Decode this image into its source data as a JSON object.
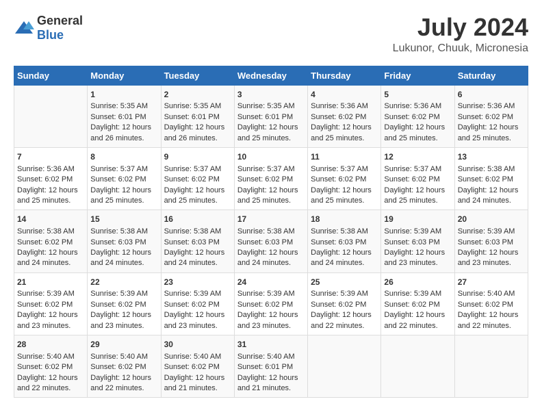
{
  "header": {
    "logo_general": "General",
    "logo_blue": "Blue",
    "month_year": "July 2024",
    "location": "Lukunor, Chuuk, Micronesia"
  },
  "weekdays": [
    "Sunday",
    "Monday",
    "Tuesday",
    "Wednesday",
    "Thursday",
    "Friday",
    "Saturday"
  ],
  "weeks": [
    [
      {
        "day": "",
        "content": ""
      },
      {
        "day": "1",
        "content": "Sunrise: 5:35 AM\nSunset: 6:01 PM\nDaylight: 12 hours\nand 26 minutes."
      },
      {
        "day": "2",
        "content": "Sunrise: 5:35 AM\nSunset: 6:01 PM\nDaylight: 12 hours\nand 26 minutes."
      },
      {
        "day": "3",
        "content": "Sunrise: 5:35 AM\nSunset: 6:01 PM\nDaylight: 12 hours\nand 25 minutes."
      },
      {
        "day": "4",
        "content": "Sunrise: 5:36 AM\nSunset: 6:02 PM\nDaylight: 12 hours\nand 25 minutes."
      },
      {
        "day": "5",
        "content": "Sunrise: 5:36 AM\nSunset: 6:02 PM\nDaylight: 12 hours\nand 25 minutes."
      },
      {
        "day": "6",
        "content": "Sunrise: 5:36 AM\nSunset: 6:02 PM\nDaylight: 12 hours\nand 25 minutes."
      }
    ],
    [
      {
        "day": "7",
        "content": "Sunrise: 5:36 AM\nSunset: 6:02 PM\nDaylight: 12 hours\nand 25 minutes."
      },
      {
        "day": "8",
        "content": "Sunrise: 5:37 AM\nSunset: 6:02 PM\nDaylight: 12 hours\nand 25 minutes."
      },
      {
        "day": "9",
        "content": "Sunrise: 5:37 AM\nSunset: 6:02 PM\nDaylight: 12 hours\nand 25 minutes."
      },
      {
        "day": "10",
        "content": "Sunrise: 5:37 AM\nSunset: 6:02 PM\nDaylight: 12 hours\nand 25 minutes."
      },
      {
        "day": "11",
        "content": "Sunrise: 5:37 AM\nSunset: 6:02 PM\nDaylight: 12 hours\nand 25 minutes."
      },
      {
        "day": "12",
        "content": "Sunrise: 5:37 AM\nSunset: 6:02 PM\nDaylight: 12 hours\nand 25 minutes."
      },
      {
        "day": "13",
        "content": "Sunrise: 5:38 AM\nSunset: 6:02 PM\nDaylight: 12 hours\nand 24 minutes."
      }
    ],
    [
      {
        "day": "14",
        "content": "Sunrise: 5:38 AM\nSunset: 6:02 PM\nDaylight: 12 hours\nand 24 minutes."
      },
      {
        "day": "15",
        "content": "Sunrise: 5:38 AM\nSunset: 6:03 PM\nDaylight: 12 hours\nand 24 minutes."
      },
      {
        "day": "16",
        "content": "Sunrise: 5:38 AM\nSunset: 6:03 PM\nDaylight: 12 hours\nand 24 minutes."
      },
      {
        "day": "17",
        "content": "Sunrise: 5:38 AM\nSunset: 6:03 PM\nDaylight: 12 hours\nand 24 minutes."
      },
      {
        "day": "18",
        "content": "Sunrise: 5:38 AM\nSunset: 6:03 PM\nDaylight: 12 hours\nand 24 minutes."
      },
      {
        "day": "19",
        "content": "Sunrise: 5:39 AM\nSunset: 6:03 PM\nDaylight: 12 hours\nand 23 minutes."
      },
      {
        "day": "20",
        "content": "Sunrise: 5:39 AM\nSunset: 6:03 PM\nDaylight: 12 hours\nand 23 minutes."
      }
    ],
    [
      {
        "day": "21",
        "content": "Sunrise: 5:39 AM\nSunset: 6:02 PM\nDaylight: 12 hours\nand 23 minutes."
      },
      {
        "day": "22",
        "content": "Sunrise: 5:39 AM\nSunset: 6:02 PM\nDaylight: 12 hours\nand 23 minutes."
      },
      {
        "day": "23",
        "content": "Sunrise: 5:39 AM\nSunset: 6:02 PM\nDaylight: 12 hours\nand 23 minutes."
      },
      {
        "day": "24",
        "content": "Sunrise: 5:39 AM\nSunset: 6:02 PM\nDaylight: 12 hours\nand 23 minutes."
      },
      {
        "day": "25",
        "content": "Sunrise: 5:39 AM\nSunset: 6:02 PM\nDaylight: 12 hours\nand 22 minutes."
      },
      {
        "day": "26",
        "content": "Sunrise: 5:39 AM\nSunset: 6:02 PM\nDaylight: 12 hours\nand 22 minutes."
      },
      {
        "day": "27",
        "content": "Sunrise: 5:40 AM\nSunset: 6:02 PM\nDaylight: 12 hours\nand 22 minutes."
      }
    ],
    [
      {
        "day": "28",
        "content": "Sunrise: 5:40 AM\nSunset: 6:02 PM\nDaylight: 12 hours\nand 22 minutes."
      },
      {
        "day": "29",
        "content": "Sunrise: 5:40 AM\nSunset: 6:02 PM\nDaylight: 12 hours\nand 22 minutes."
      },
      {
        "day": "30",
        "content": "Sunrise: 5:40 AM\nSunset: 6:02 PM\nDaylight: 12 hours\nand 21 minutes."
      },
      {
        "day": "31",
        "content": "Sunrise: 5:40 AM\nSunset: 6:01 PM\nDaylight: 12 hours\nand 21 minutes."
      },
      {
        "day": "",
        "content": ""
      },
      {
        "day": "",
        "content": ""
      },
      {
        "day": "",
        "content": ""
      }
    ]
  ]
}
